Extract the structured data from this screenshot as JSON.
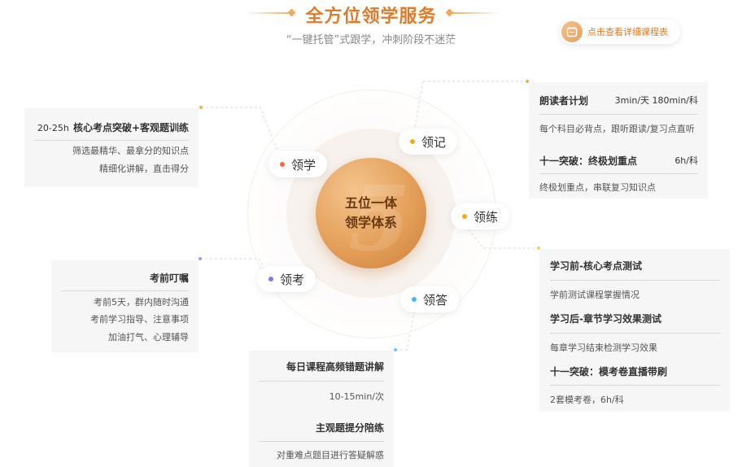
{
  "header": {
    "title": "全方位领学服务",
    "subtitle": "“一键托管”式跟学，冲刺阶段不迷茫",
    "schedule_button": "点击查看详细课程表"
  },
  "center": {
    "line1": "五位一体",
    "line2": "领学体系",
    "watermark": "5"
  },
  "pills": {
    "lingxue": "领学",
    "lingji": "领记",
    "linglian": "领练",
    "lingkao": "领考",
    "lingda": "领答"
  },
  "colors": {
    "accent": "#e07b2a",
    "dot_red": "#f26a3d",
    "dot_orange": "#f5a623",
    "dot_purple": "#7b7ef0",
    "dot_blue": "#4cb8e8"
  },
  "card_lingxue": {
    "hours": "20-25h",
    "title": "核心考点突破+客观题训练",
    "line1": "筛选最精华、最拿分的知识点",
    "line2": "精细化讲解，直击得分"
  },
  "card_lingji": {
    "title1": "朗读者计划",
    "meta1": "3min/天 180min/科",
    "text1": "每个科目必背点，跟听跟读/复习点直听",
    "title2": "十一突破：终极划重点",
    "meta2": "6h/科",
    "text2": "终极划重点，串联复习知识点"
  },
  "card_linglian": {
    "title1": "学习前-核心考点测试",
    "text1": "学前测试课程掌握情况",
    "title2": "学习后-章节学习效果测试",
    "text2": "每章学习结束检测学习效果",
    "title3": "十一突破：模考卷直播带刷",
    "text3": "2套模考卷，6h/科"
  },
  "card_lingkao": {
    "title": "考前叮嘱",
    "line1": "考前5天，群内随时沟通",
    "line2": "考前学习指导、注意事项",
    "line3": "加油打气、心理辅导"
  },
  "card_lingda": {
    "title1": "每日课程高频错题讲解",
    "meta1": "10-15min/次",
    "title2": "主观题提分陪练",
    "text2": "对重难点题目进行答疑解惑"
  }
}
